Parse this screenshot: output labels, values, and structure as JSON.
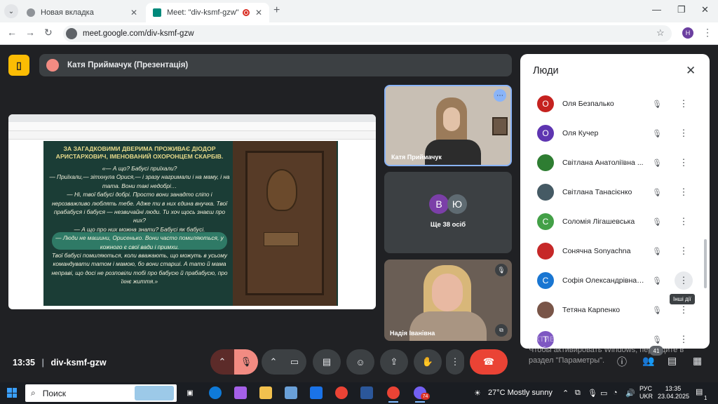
{
  "browser": {
    "tabs": [
      {
        "title": "Новая вкладка",
        "active": false
      },
      {
        "title": "Meet: \"div-ksmf-gzw\"",
        "active": true
      }
    ],
    "url": "meet.google.com/div-ksmf-gzw",
    "profile_initial": "H"
  },
  "meet": {
    "presenter_bar": "Катя Приймачук (Презентація)",
    "slide": {
      "heading": "ЗА ЗАГАДКОВИМИ ДВЕРИМА ПРОЖИВАЄ ДІОДОР АРИСТАРХОВИЧ, ІМЕНОВАНИЙ ОХОРОНЦЕМ СКАРБІВ.",
      "text": "«— А що? Бабусі приїхали?\n— Приїхали,— зітхнула Орися,— і зразу нагримали і на маму, і на тата. Вони такі недобрі…\n— Ні, твої бабусі добрі. Просто вони занадто сліпо і нерозважливо люблять тебе. Адже ти в них єдина внучка. Твої прабабуся і бабуся — незвичайні люди. Ти хоч щось знаєш про них?\n— А що про них можна знати? Бабусі як бабусі.\n— Люди не машини, Орисенько. Вони часто помиляються, у кожного є свої вади і примхи.\nТвої бабусі помиляються, коли вважають, що можуть в усьому командувати татом і мамою, бо вони старші. А тато й мама неправі, що досі не розповіли тобі про бабусю й прабабусю, про їхнє життя.»"
    },
    "tiles": {
      "presenter_name": "Катя Приймачук",
      "others_label": "Ще 38 осіб",
      "others_avatars": [
        {
          "letter": "В",
          "color": "#7b3fa8"
        },
        {
          "letter": "Ю",
          "color": "#5f6b72"
        }
      ],
      "bottom_name": "Надія Іванівна"
    },
    "people_panel": {
      "title": "Люди",
      "participants": [
        {
          "name": "Оля Безпалько",
          "avatar": "О",
          "color": "#c5221f"
        },
        {
          "name": "Оля Кучер",
          "avatar": "О",
          "color": "#5e35b1"
        },
        {
          "name": "Світлана Анатоліївна ...",
          "avatar": "",
          "color": "#2e7d32"
        },
        {
          "name": "Світлана Танасієнко",
          "avatar": "",
          "color": "#455a64"
        },
        {
          "name": "Соломія Лігашевська",
          "avatar": "С",
          "color": "#43a047"
        },
        {
          "name": "Сонячна Sonyachna",
          "avatar": "",
          "color": "#c62828"
        },
        {
          "name": "Софія Олександрівна Г...",
          "avatar": "С",
          "color": "#1976d2"
        },
        {
          "name": "Тетяна Карпенко",
          "avatar": "",
          "color": "#795548"
        },
        {
          "name": "",
          "avatar": "Т",
          "color": "#7e57c2"
        }
      ],
      "tooltip": "Інші дії"
    },
    "bottom_bar": {
      "time": "13:35",
      "separator": "|",
      "meeting_code": "div-ksmf-gzw",
      "people_badge": "41"
    },
    "activation_watermark": {
      "title": "Активация Windows",
      "text": "Чтобы активировать Windows, перейдите в раздел \"Параметры\"."
    }
  },
  "taskbar": {
    "search_placeholder": "Поиск",
    "weather": "27°C  Mostly sunny",
    "lang_top": "РУС",
    "lang_bottom": "UKR",
    "time": "13:35",
    "date": "23.04.2025",
    "viber_badge": "74",
    "notifications": "1"
  }
}
